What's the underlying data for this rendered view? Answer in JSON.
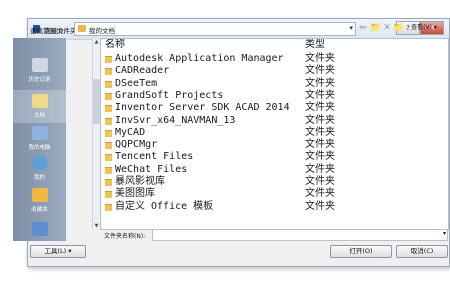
{
  "window": {
    "title": "浏览文件夹",
    "help_glyph": "?",
    "close_glyph": "✕"
  },
  "lookin": {
    "label": "查找范围(I):",
    "value": "我的文档"
  },
  "toolbar": {
    "back": "⇦",
    "up": "📁",
    "delete": "✕",
    "newfolder": "📁",
    "views_label": "查看(V)"
  },
  "places": [
    {
      "label": "历史记录",
      "icon": "history-icon",
      "color": "#cfd8e4"
    },
    {
      "label": "文档",
      "icon": "documents-icon",
      "color": "#f2d98a"
    },
    {
      "label": "我的电脑",
      "icon": "computer-icon",
      "color": "#8fb3e0"
    },
    {
      "label": "我的",
      "icon": "network-icon",
      "color": "#5aa0d8"
    },
    {
      "label": "收藏夹",
      "icon": "favorites-icon",
      "color": "#f0b742"
    },
    {
      "label": "",
      "icon": "desktop-icon",
      "color": "#5b8fd0"
    }
  ],
  "columns": {
    "name": "名称",
    "type": "类型"
  },
  "files": [
    {
      "name": "Autodesk Application Manager",
      "type": "文件夹"
    },
    {
      "name": "CADReader",
      "type": "文件夹"
    },
    {
      "name": "DSeeTem",
      "type": "文件夹"
    },
    {
      "name": "GrandSoft Projects",
      "type": "文件夹"
    },
    {
      "name": "Inventor Server SDK ACAD 2014",
      "type": "文件夹"
    },
    {
      "name": "InvSvr_x64_NAVMAN_13",
      "type": "文件夹"
    },
    {
      "name": "MyCAD",
      "type": "文件夹"
    },
    {
      "name": "QQPCMgr",
      "type": "文件夹"
    },
    {
      "name": "Tencent Files",
      "type": "文件夹"
    },
    {
      "name": "WeChat Files",
      "type": "文件夹"
    },
    {
      "name": "暴风影视库",
      "type": "文件夹"
    },
    {
      "name": "美图图库",
      "type": "文件夹"
    },
    {
      "name": "自定义 Office 模板",
      "type": "文件夹"
    }
  ],
  "filename": {
    "label": "文件夹名称(N):",
    "value": ""
  },
  "buttons": {
    "tools": "工具(L)",
    "open": "打开(O)",
    "cancel": "取消(C)"
  }
}
